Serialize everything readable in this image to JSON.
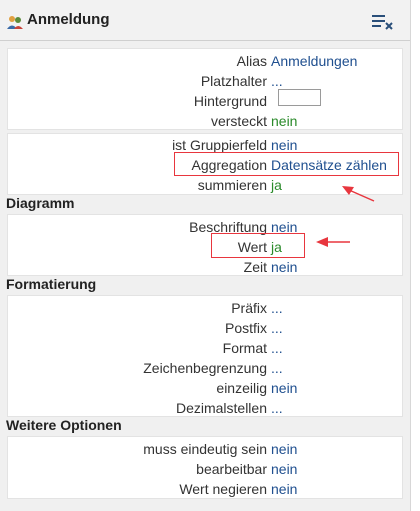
{
  "header": {
    "title": "Anmeldung"
  },
  "group1": [
    {
      "label": "Alias",
      "value": "Anmeldungen",
      "color": "#1f4f8f"
    },
    {
      "label": "Platzhalter",
      "value": "...",
      "color": "#1f4f8f"
    },
    {
      "label": "Hintergrund",
      "value": "",
      "color": "#1f4f8f"
    },
    {
      "label": "versteckt",
      "value": "nein",
      "color": "#2a8a2a"
    }
  ],
  "group2": [
    {
      "label": "ist Gruppierfeld",
      "value": "nein",
      "color": "#1f4f8f"
    },
    {
      "label": "Aggregation",
      "value": "Datensätze zählen",
      "color": "#1f4f8f"
    },
    {
      "label": "summieren",
      "value": "ja",
      "color": "#2a8a2a"
    }
  ],
  "sections": {
    "diagramm": "Diagramm",
    "formatierung": "Formatierung",
    "weitere": "Weitere Optionen"
  },
  "diagramm": [
    {
      "label": "Beschriftung",
      "value": "nein",
      "color": "#1f4f8f"
    },
    {
      "label": "Wert",
      "value": "ja",
      "color": "#2a8a2a"
    },
    {
      "label": "Zeit",
      "value": "nein",
      "color": "#1f4f8f"
    }
  ],
  "formatierung": [
    {
      "label": "Präfix",
      "value": "...",
      "color": "#1f4f8f"
    },
    {
      "label": "Postfix",
      "value": "...",
      "color": "#1f4f8f"
    },
    {
      "label": "Format",
      "value": "...",
      "color": "#1f4f8f"
    },
    {
      "label": "Zeichenbegrenzung",
      "value": "...",
      "color": "#1f4f8f"
    },
    {
      "label": "einzeilig",
      "value": "nein",
      "color": "#1f4f8f"
    },
    {
      "label": "Dezimalstellen",
      "value": "...",
      "color": "#1f4f8f"
    }
  ],
  "weitere": [
    {
      "label": "muss eindeutig sein",
      "value": "nein",
      "color": "#1f4f8f"
    },
    {
      "label": "bearbeitbar",
      "value": "nein",
      "color": "#1f4f8f"
    },
    {
      "label": "Wert negieren",
      "value": "nein",
      "color": "#1f4f8f"
    }
  ],
  "annotation_color": "#e8363e"
}
